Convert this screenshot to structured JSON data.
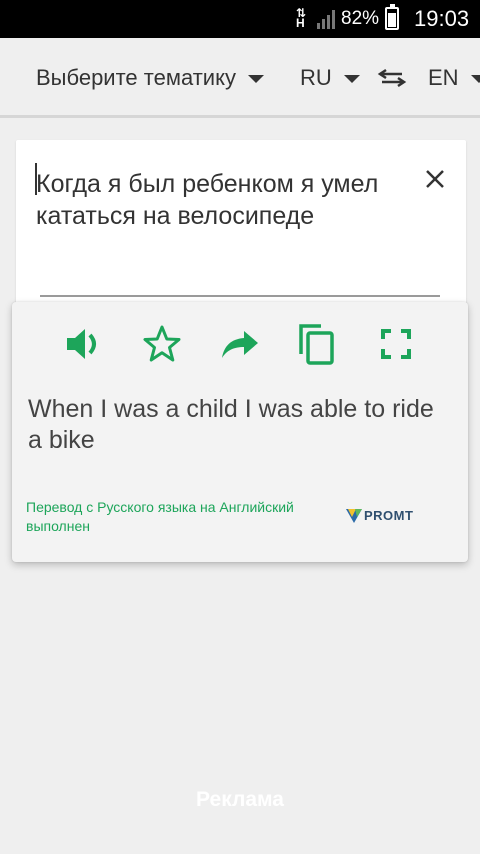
{
  "status_bar": {
    "network": "H",
    "battery_percent": "82%",
    "time": "19:03"
  },
  "toolbar": {
    "topic_label": "Выберите тематику",
    "source_lang": "RU",
    "target_lang": "EN"
  },
  "input": {
    "text": "Когда я был ребенком я умел кататься на велосипеде"
  },
  "translation": {
    "text": "When I was a child I was able to ride a bike",
    "credit": "Перевод с Русского языка на Английский выполнен",
    "provider_logo": "PROMT"
  },
  "footer": {
    "ad_label": "Реклама"
  },
  "colors": {
    "accent": "#1da55a",
    "status_bar": "#000000",
    "background": "#efefef"
  }
}
